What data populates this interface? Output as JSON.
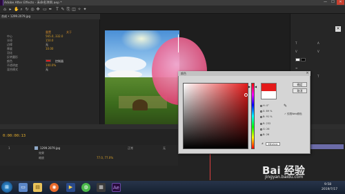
{
  "window": {
    "title": "Adobe After Effects - 未命名项目.aep *",
    "minimize": "—",
    "maximize": "☐",
    "close": "✕"
  },
  "effects_panel": {
    "tab": "合成 • 1299.2079.jpg",
    "header_col1": "重置",
    "header_col2": "关于",
    "rows": [
      {
        "label": "中心",
        "value": "565.0, 332.0"
      },
      {
        "label": "半径",
        "value": "150.0"
      },
      {
        "label": "边缘",
        "value": "无"
      },
      {
        "label": "厚度",
        "value": "10.00"
      },
      {
        "label": "羽化",
        "value": ""
      },
      {
        "label": "反转圆形",
        "value": ""
      },
      {
        "label": "颜色",
        "value": "控制器"
      },
      {
        "label": "不透明度",
        "value": "100.0%"
      },
      {
        "label": "混合模式",
        "value": "无"
      }
    ]
  },
  "color_dialog": {
    "title": "颜色",
    "close": "×",
    "ok_label": "确定",
    "cancel_label": "取消",
    "fields": [
      {
        "label": "H:",
        "value": "0°"
      },
      {
        "label": "S:",
        "value": "89 %"
      },
      {
        "label": "B:",
        "value": "91 %"
      },
      {
        "label": "R:",
        "value": "232"
      },
      {
        "label": "G:",
        "value": "26"
      },
      {
        "label": "B:",
        "value": "26"
      }
    ],
    "eyedropper": "✎",
    "only_web_colors": "仅限Web颜色",
    "hex": "E81A1A",
    "new_color": "#e41a1a",
    "current_color": "#ffffff"
  },
  "timeline": {
    "timecode": "0:00:00:13",
    "layer_name": "1299.2079.jpg",
    "effect_label": "效果",
    "scale_label": "缩放",
    "scale_value": "77.0, 77.0%",
    "mode_label": "正常",
    "parent_label": "无"
  },
  "taskbar": {
    "start": "⊞",
    "time": "9:58",
    "date": "2019/7/17"
  },
  "watermark": {
    "logo": "Bai 经验",
    "url": "jingyan.baidu.com"
  }
}
